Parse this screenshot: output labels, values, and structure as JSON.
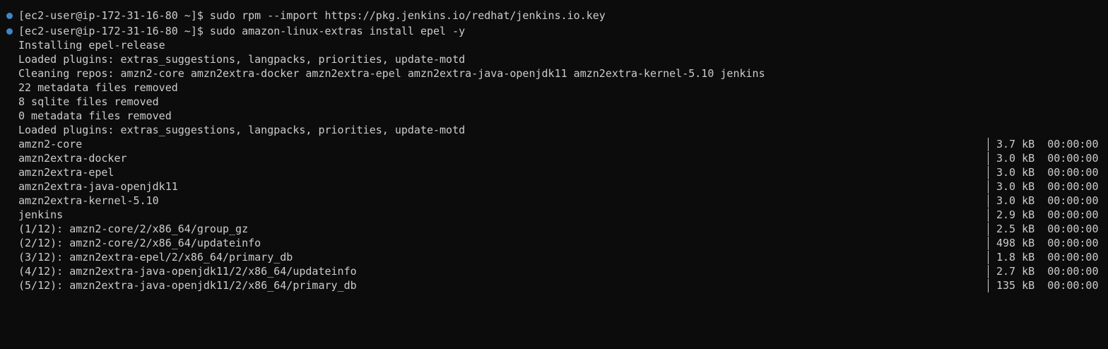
{
  "terminal": {
    "prompt_lines": [
      "[ec2-user@ip-172-31-16-80 ~]$ sudo rpm --import https://pkg.jenkins.io/redhat/jenkins.io.key",
      "[ec2-user@ip-172-31-16-80 ~]$ sudo amazon-linux-extras install epel -y"
    ],
    "output_lines": [
      "Installing epel-release",
      "Loaded plugins: extras_suggestions, langpacks, priorities, update-motd",
      "Cleaning repos: amzn2-core amzn2extra-docker amzn2extra-epel amzn2extra-java-openjdk11 amzn2extra-kernel-5.10 jenkins",
      "22 metadata files removed",
      "8 sqlite files removed",
      "0 metadata files removed",
      "Loaded plugins: extras_suggestions, langpacks, priorities, update-motd"
    ],
    "download_rows": [
      {
        "name": "amzn2-core",
        "size": "3.7 kB",
        "time": "00:00:00"
      },
      {
        "name": "amzn2extra-docker",
        "size": "3.0 kB",
        "time": "00:00:00"
      },
      {
        "name": "amzn2extra-epel",
        "size": "3.0 kB",
        "time": "00:00:00"
      },
      {
        "name": "amzn2extra-java-openjdk11",
        "size": "3.0 kB",
        "time": "00:00:00"
      },
      {
        "name": "amzn2extra-kernel-5.10",
        "size": "3.0 kB",
        "time": "00:00:00"
      },
      {
        "name": "jenkins",
        "size": "2.9 kB",
        "time": "00:00:00"
      },
      {
        "name": "(1/12): amzn2-core/2/x86_64/group_gz",
        "size": "2.5 kB",
        "time": "00:00:00"
      },
      {
        "name": "(2/12): amzn2-core/2/x86_64/updateinfo",
        "size": "498 kB",
        "time": "00:00:00"
      },
      {
        "name": "(3/12): amzn2extra-epel/2/x86_64/primary_db",
        "size": "1.8 kB",
        "time": "00:00:00"
      },
      {
        "name": "(4/12): amzn2extra-java-openjdk11/2/x86_64/updateinfo",
        "size": "2.7 kB",
        "time": "00:00:00"
      },
      {
        "name": "(5/12): amzn2extra-java-openjdk11/2/x86_64/primary_db",
        "size": "135 kB",
        "time": "00:00:00"
      }
    ]
  },
  "colors": {
    "background": "#0c0c0c",
    "text": "#cccccc",
    "decoration_dot": "#3f86c9"
  }
}
